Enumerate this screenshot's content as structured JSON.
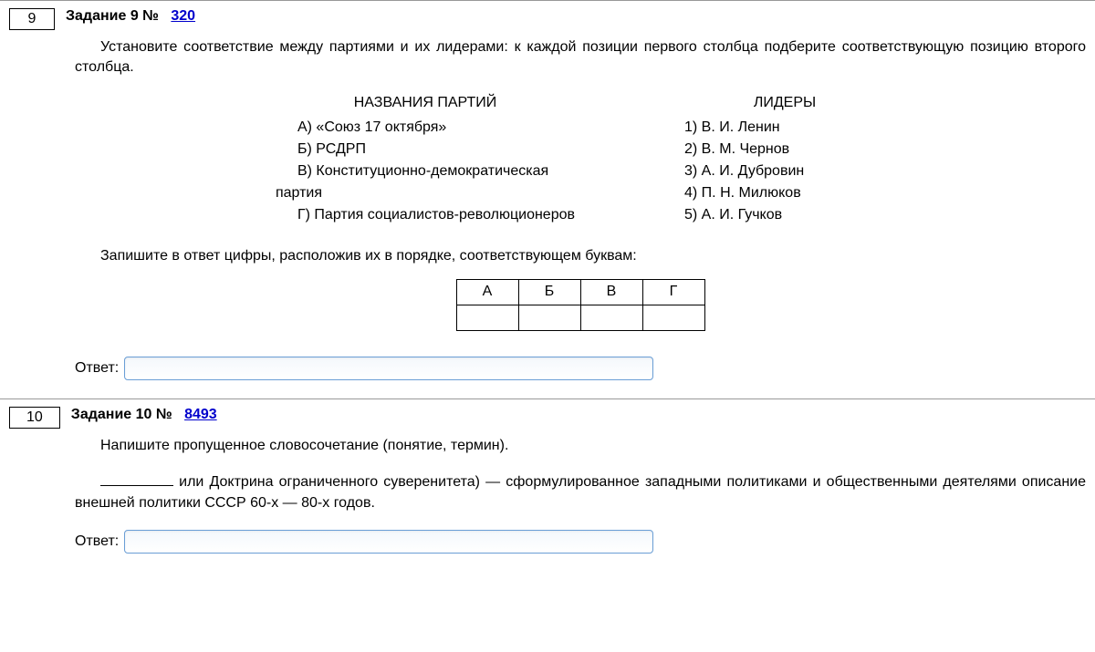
{
  "tasks": [
    {
      "num": "9",
      "title_prefix": "Задание 9 №",
      "link": "320",
      "intro": "Установите соответствие между партиями и их лидерами: к каждой позиции первого столбца подберите соответствующую позицию второго столбца.",
      "left_header": "НАЗВАНИЯ ПАРТИЙ",
      "left_items": [
        "A) «Союз 17 октября»",
        "Б) РСДРП",
        "B) Конституционно-демократическая партия",
        "Г) Партия социалистов-революционеров"
      ],
      "right_header": "ЛИДЕРЫ",
      "right_items": [
        "1) В. И. Ленин",
        "2) В. М. Чернов",
        "3) А. И. Дубровин",
        "4) П. Н. Милюков",
        "5) А. И. Гучков"
      ],
      "answer_instruction": "Запишите в ответ цифры, расположив их в порядке, соответствующем буквам:",
      "table_letters": [
        "А",
        "Б",
        "В",
        "Г"
      ],
      "answer_label": "Ответ:"
    },
    {
      "num": "10",
      "title_prefix": "Задание 10 №",
      "link": "8493",
      "intro1": "Напишите пропущенное словосочетание (понятие, термин).",
      "intro2_before": "",
      "intro2_after": " или Доктрина ограниченного суверенитета) — сформулированное западными политиками и общественными деятелями описание внешней политики СССР 60-х — 80-х годов.",
      "answer_label": "Ответ:"
    }
  ]
}
